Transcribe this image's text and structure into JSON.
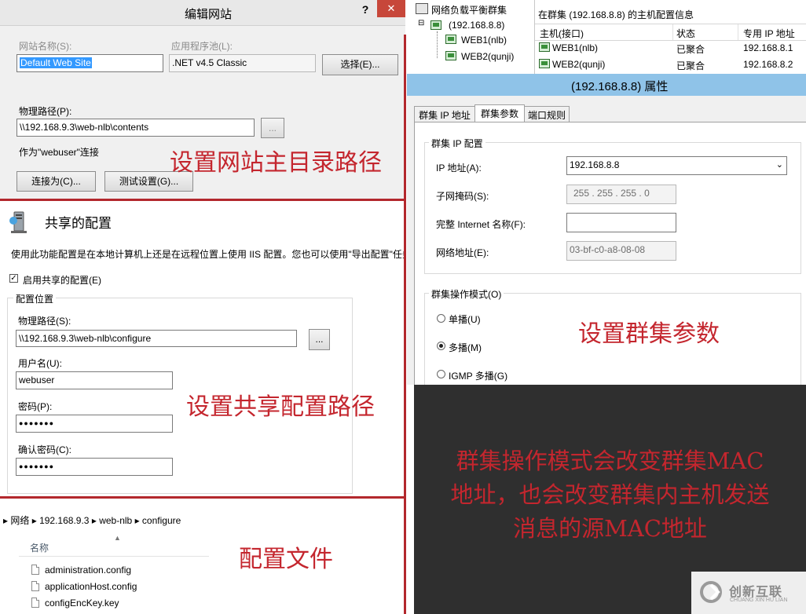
{
  "edit_site": {
    "title": "编辑网站",
    "help": "?",
    "close": "✕",
    "site_name_label": "网站名称(S):",
    "site_name_value": "Default Web Site",
    "app_pool_label": "应用程序池(L):",
    "app_pool_value": ".NET v4.5 Classic",
    "select_button": "选择(E)...",
    "physical_path_label": "物理路径(P):",
    "physical_path_value": "\\\\192.168.9.3\\web-nlb\\contents",
    "browse_button": "...",
    "connect_as_text": "作为\"webuser\"连接",
    "connect_as_button": "连接为(C)...",
    "test_settings_button": "测试设置(G)..."
  },
  "nlb_tree": {
    "root": "网络负载平衡群集",
    "cluster": "(192.168.8.8)",
    "hosts": [
      "WEB1(nlb)",
      "WEB2(qunji)"
    ]
  },
  "host_table": {
    "title": "在群集 (192.168.8.8) 的主机配置信息",
    "columns": [
      "主机(接口)",
      "状态",
      "专用 IP 地址"
    ],
    "rows": [
      [
        "WEB1(nlb)",
        "已聚合",
        "192.168.8.1"
      ],
      [
        "WEB2(qunji)",
        "已聚合",
        "192.168.8.2"
      ]
    ]
  },
  "cluster_props": {
    "title": "(192.168.8.8) 属性",
    "tabs": [
      "群集 IP 地址",
      "群集参数",
      "端口规则"
    ],
    "ip_group": "群集 IP 配置",
    "ip_label": "IP 地址(A):",
    "ip_value": "192.168.8.8",
    "mask_label": "子网掩码(S):",
    "mask_value": "255 . 255 . 255 .  0",
    "internet_label": "完整 Internet 名称(F):",
    "internet_value": "",
    "net_label": "网络地址(E):",
    "net_value": "03-bf-c0-a8-08-08",
    "mode_group": "群集操作模式(O)",
    "modes": [
      "单播(U)",
      "多播(M)",
      "IGMP 多播(G)"
    ],
    "selected_mode": 1
  },
  "shared_config": {
    "title": "共享的配置",
    "description": "使用此功能配置是在本地计算机上还是在远程位置上使用 IIS 配置。您也可以使用\"导出配置\"任务导出配置",
    "enable_label": "启用共享的配置(E)",
    "enabled": true,
    "location_group": "配置位置",
    "path_label": "物理路径(S):",
    "path_value": "\\\\192.168.9.3\\web-nlb\\configure",
    "browse_button": "...",
    "username_label": "用户名(U):",
    "username_value": "webuser",
    "password_label": "密码(P):",
    "password_value": "●●●●●●●",
    "confirm_label": "确认密码(C):",
    "confirm_value": "●●●●●●●"
  },
  "explorer": {
    "breadcrumb": [
      "网络",
      "192.168.9.3",
      "web-nlb",
      "configure"
    ],
    "column_name": "名称",
    "files": [
      "administration.config",
      "applicationHost.config",
      "configEncKey.key"
    ]
  },
  "annotations": {
    "site_path": "设置网站主目录路径",
    "shared_path": "设置共享配置路径",
    "cluster_params": "设置群集参数",
    "mode_note": [
      "群集操作模式会改变群集MAC",
      "地址，也会改变群集内主机发送",
      "消息的源MAC地址"
    ],
    "config_files": "配置文件"
  },
  "watermark": {
    "name": "创新互联",
    "sub": "CHUANG XIN HU LIAN"
  },
  "colors": {
    "annotation": "#c4262e",
    "dialog_title": "#e8e8e8",
    "props_title": "#8fc3e8",
    "dark_panel": "#2f2f2f",
    "close_button": "#c7473a"
  }
}
